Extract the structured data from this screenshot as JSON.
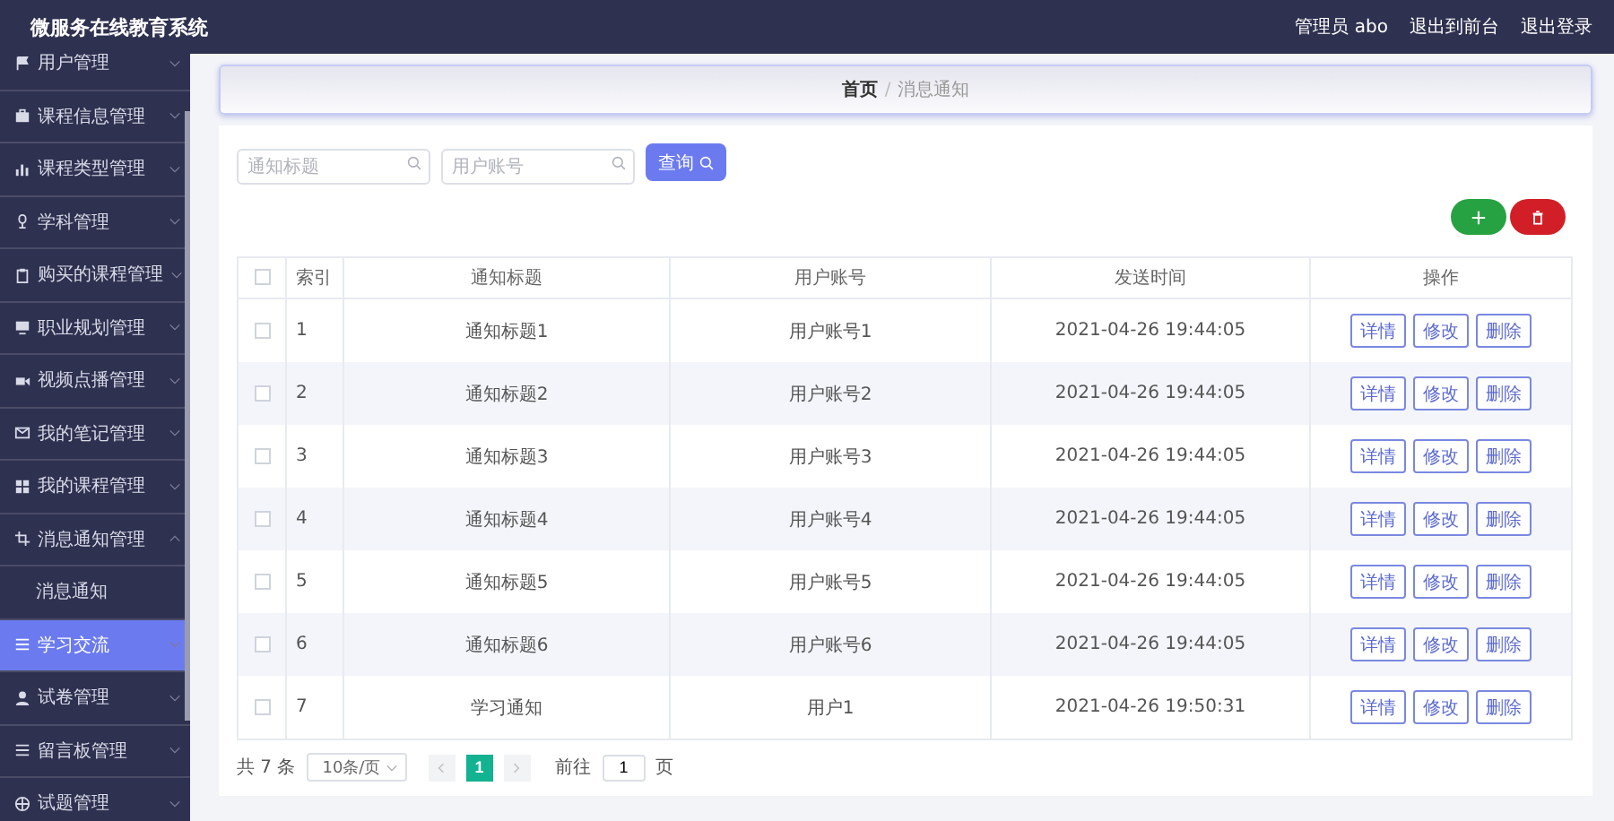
{
  "header": {
    "title": "微服务在线教育系统",
    "links": [
      "管理员 abo",
      "退出到前台",
      "退出登录"
    ]
  },
  "sidebar": {
    "items": [
      {
        "label": "用户管理",
        "expanded": false,
        "selected": false
      },
      {
        "label": "课程信息管理",
        "expanded": false,
        "selected": false
      },
      {
        "label": "课程类型管理",
        "expanded": false,
        "selected": false
      },
      {
        "label": "学科管理",
        "expanded": false,
        "selected": false
      },
      {
        "label": "购买的课程管理",
        "expanded": false,
        "selected": false
      },
      {
        "label": "职业规划管理",
        "expanded": false,
        "selected": false
      },
      {
        "label": "视频点播管理",
        "expanded": false,
        "selected": false
      },
      {
        "label": "我的笔记管理",
        "expanded": false,
        "selected": false
      },
      {
        "label": "我的课程管理",
        "expanded": false,
        "selected": false
      },
      {
        "label": "消息通知管理",
        "expanded": true,
        "selected": false,
        "children": [
          {
            "label": "消息通知",
            "selected": false
          }
        ]
      },
      {
        "label": "学习交流",
        "expanded": false,
        "selected": true
      },
      {
        "label": "试卷管理",
        "expanded": false,
        "selected": false
      },
      {
        "label": "留言板管理",
        "expanded": false,
        "selected": false
      },
      {
        "label": "试题管理",
        "expanded": false,
        "selected": false
      }
    ]
  },
  "breadcrumb": {
    "items": [
      "首页",
      "消息通知"
    ],
    "separator": "/"
  },
  "search": {
    "fields": [
      {
        "placeholder": "通知标题"
      },
      {
        "placeholder": "用户账号"
      }
    ],
    "button": "查询"
  },
  "table": {
    "select_all_checked": false,
    "columns": [
      "索引",
      "通知标题",
      "用户账号",
      "发送时间",
      "操作"
    ],
    "rows": [
      {
        "checked": false,
        "cells": [
          "1",
          "通知标题1",
          "用户账号1",
          "2021-04-26 19:44:05"
        ],
        "actions": [
          "详情",
          "修改",
          "删除"
        ]
      },
      {
        "checked": false,
        "cells": [
          "2",
          "通知标题2",
          "用户账号2",
          "2021-04-26 19:44:05"
        ],
        "actions": [
          "详情",
          "修改",
          "删除"
        ]
      },
      {
        "checked": false,
        "cells": [
          "3",
          "通知标题3",
          "用户账号3",
          "2021-04-26 19:44:05"
        ],
        "actions": [
          "详情",
          "修改",
          "删除"
        ]
      },
      {
        "checked": false,
        "cells": [
          "4",
          "通知标题4",
          "用户账号4",
          "2021-04-26 19:44:05"
        ],
        "actions": [
          "详情",
          "修改",
          "删除"
        ]
      },
      {
        "checked": false,
        "cells": [
          "5",
          "通知标题5",
          "用户账号5",
          "2021-04-26 19:44:05"
        ],
        "actions": [
          "详情",
          "修改",
          "删除"
        ]
      },
      {
        "checked": false,
        "cells": [
          "6",
          "通知标题6",
          "用户账号6",
          "2021-04-26 19:44:05"
        ],
        "actions": [
          "详情",
          "修改",
          "删除"
        ]
      },
      {
        "checked": false,
        "cells": [
          "7",
          "学习通知",
          "用户1",
          "2021-04-26 19:50:31"
        ],
        "actions": [
          "详情",
          "修改",
          "删除"
        ]
      }
    ]
  },
  "pagination": {
    "total": "共 7 条",
    "page_size": "10条/页",
    "pages": [
      {
        "label": "1",
        "selected": true
      }
    ],
    "goto_label": "前往",
    "goto_value": "1",
    "goto_suffix": "页"
  }
}
